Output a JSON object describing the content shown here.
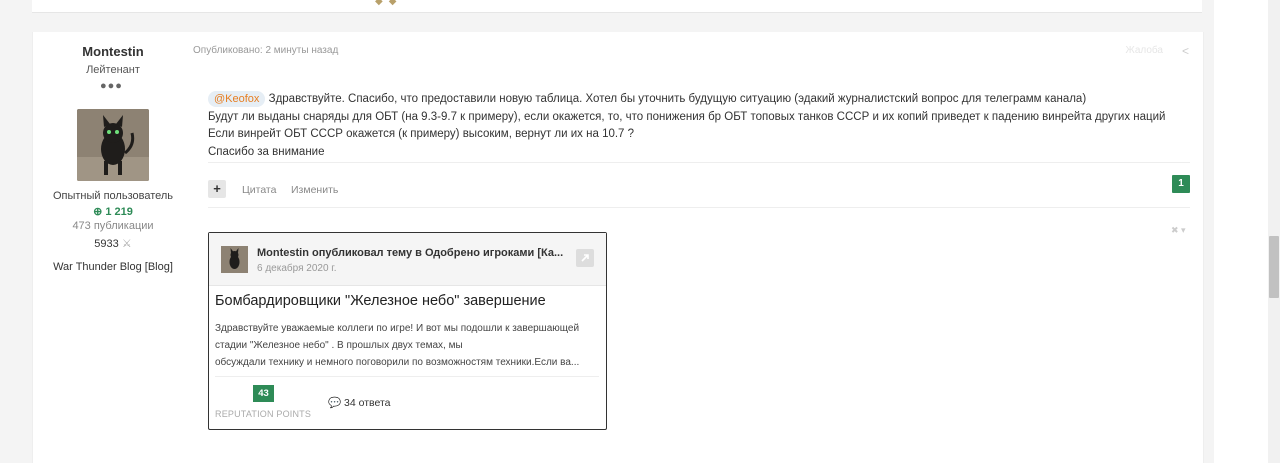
{
  "post": {
    "author": {
      "name": "Montestin",
      "rank": "Лейтенант",
      "rank_pips": "●●●",
      "group": "Опытный пользователь",
      "reputation": "1 219",
      "posts": "473 публикации",
      "points": "5933",
      "blog": "War Thunder Blog [Blog]"
    },
    "meta": "Опубликовано: 2 минуты назад",
    "report_label": "Жалоба",
    "content": {
      "mention": "@Keofox",
      "line1_rest": " Здравствуйте. Спасибо, что предоставили новую таблица. Хотел бы уточнить будущую ситуацию (эдакий журналистский вопрос для телеграмм канала)",
      "line2": " Будут ли выданы снаряды для ОБТ (на 9.3-9.7 к примеру), если окажется, то, что понижения бр ОБТ топовых танков СССР и их копий приведет к падению винрейта других наций",
      "line3": "Если винрейт ОБТ СССР окажется (к примеру) высоким, вернут ли их на 10.7 ?",
      "line4": "Спасибо за внимание"
    },
    "actions": {
      "plus": "+",
      "quote": "Цитата",
      "edit": "Изменить"
    },
    "likes": "1",
    "signature_embed": {
      "header": "Montestin опубликовал тему в Одобрено игроками [Ка...",
      "date": "6 декабря 2020 г.",
      "topic_title": "Бомбардировщики \"Железное небо\" завершение",
      "excerpt": [
        "Здравствуйте уважаемые коллеги по игре! И вот мы подошли к завершающей",
        "стадии  \"Железное небо\" . В прошлых  двух темах, мы",
        "обсуждали технику и немного  поговорили по возможностям техники.Если ва..."
      ],
      "reputation_value": "43",
      "reputation_label": "REPUTATION POINTS",
      "replies": "34 ответа"
    }
  },
  "colors": {
    "accent_green": "#2e8b57",
    "mention_text": "#e67e22",
    "background": "#f4f4f4"
  }
}
